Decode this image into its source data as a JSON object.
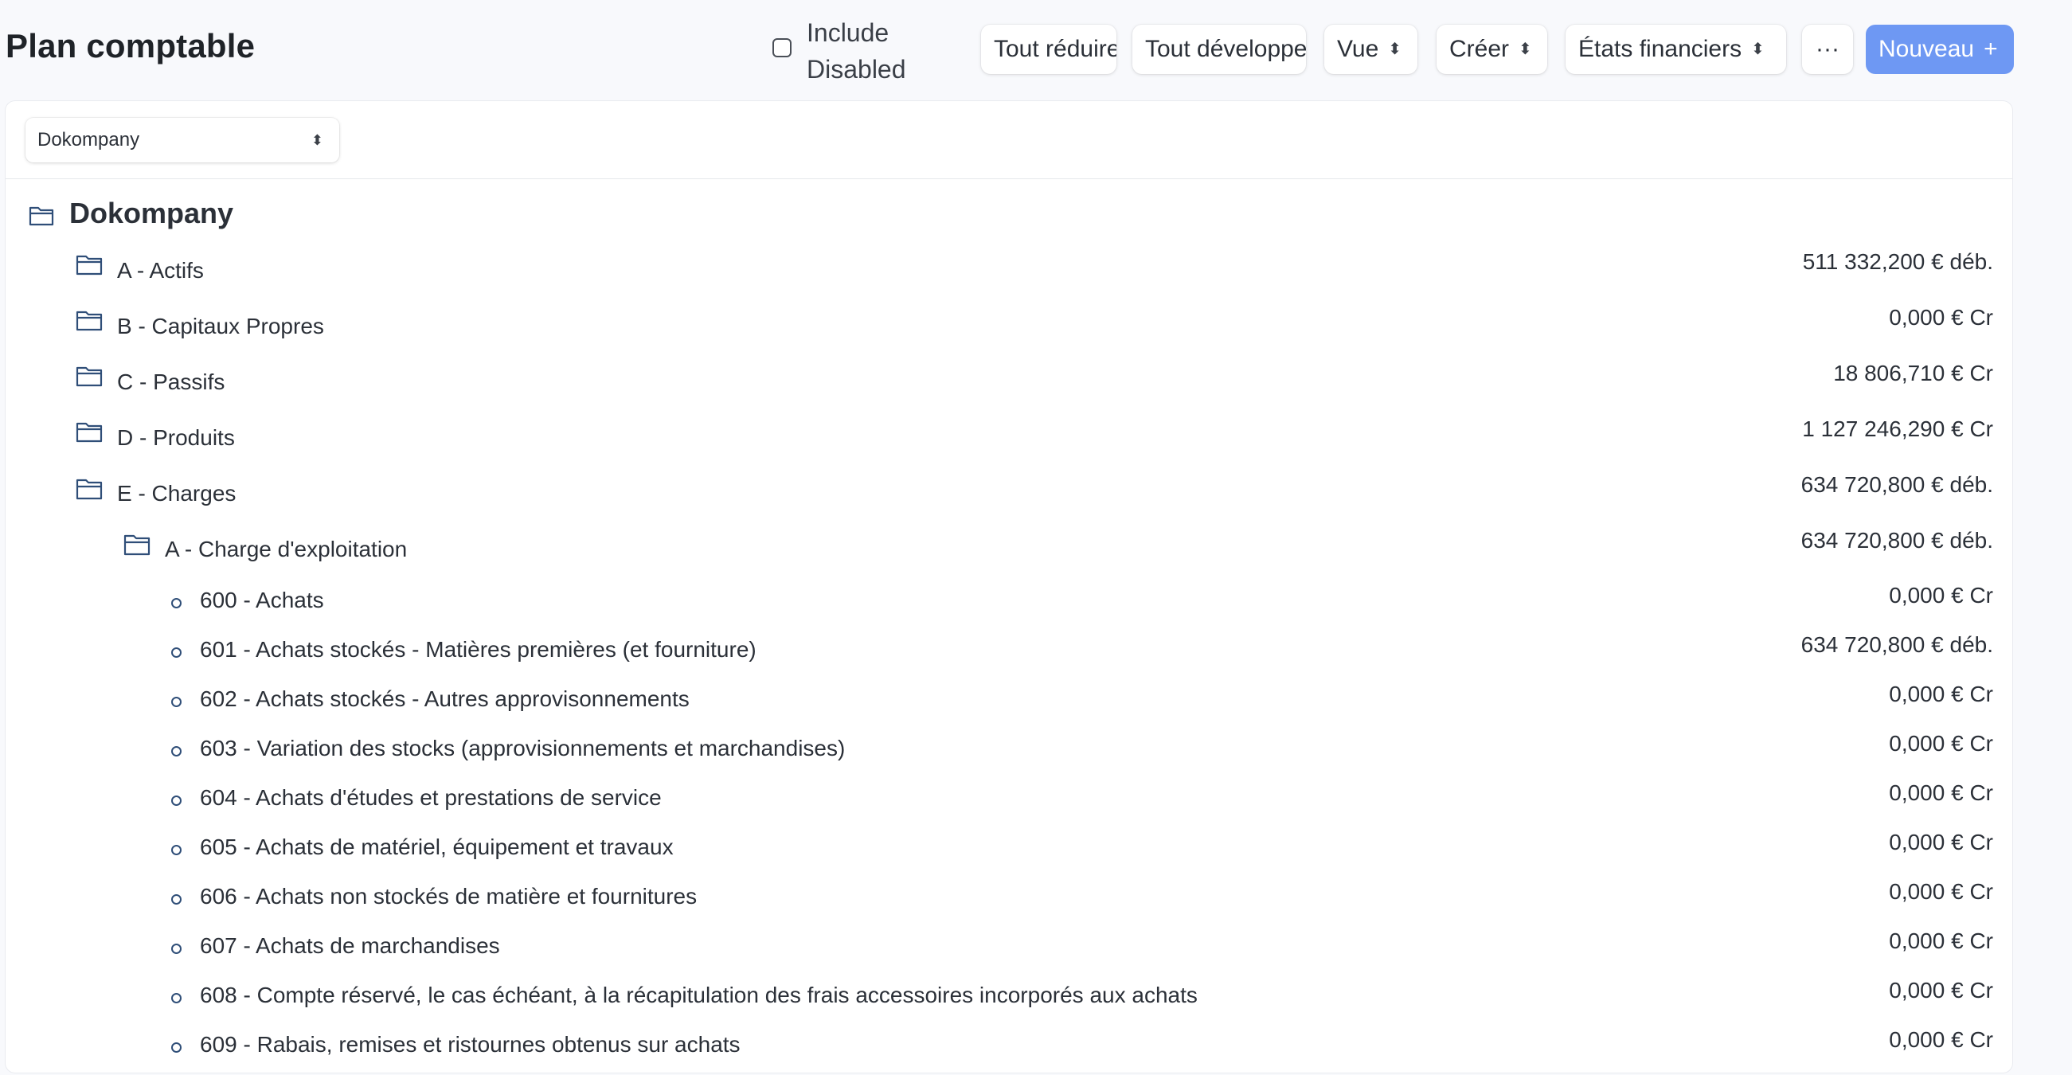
{
  "header": {
    "title": "Plan comptable",
    "include_disabled_label": "Include Disabled",
    "buttons": {
      "collapse_all": "Tout réduire",
      "expand_all": "Tout développer",
      "view": "Vue",
      "create": "Créer",
      "financial_statements": "États financiers",
      "more": "···",
      "new": "Nouveau"
    }
  },
  "company_select": {
    "value": "Dokompany"
  },
  "tree": {
    "root": {
      "label": "Dokompany",
      "icon": "folder-open-icon"
    },
    "groups": [
      {
        "label": "A - Actifs",
        "amount": "511 332,200 € déb.",
        "icon": "folder-icon"
      },
      {
        "label": "B - Capitaux Propres",
        "amount": "0,000 € Cr",
        "icon": "folder-icon"
      },
      {
        "label": "C - Passifs",
        "amount": "18 806,710 € Cr",
        "icon": "folder-icon"
      },
      {
        "label": "D - Produits",
        "amount": "1 127 246,290 € Cr",
        "icon": "folder-icon"
      },
      {
        "label": "E - Charges",
        "amount": "634 720,800 € déb.",
        "icon": "folder-open-icon"
      }
    ],
    "subgroup": {
      "label": "A - Charge d'exploitation",
      "amount": "634 720,800 € déb.",
      "icon": "folder-open-icon"
    },
    "accounts": [
      {
        "label": "600 - Achats",
        "amount": "0,000 € Cr"
      },
      {
        "label": "601 - Achats stockés - Matières premières (et fourniture)",
        "amount": "634 720,800 € déb."
      },
      {
        "label": "602 - Achats stockés - Autres approvisonnements",
        "amount": "0,000 € Cr"
      },
      {
        "label": "603 - Variation des stocks (approvisionnements et marchandises)",
        "amount": "0,000 € Cr"
      },
      {
        "label": "604 - Achats d'études et prestations de service",
        "amount": "0,000 € Cr"
      },
      {
        "label": "605 - Achats de matériel, équipement et travaux",
        "amount": "0,000 € Cr"
      },
      {
        "label": "606 - Achats non stockés de matière et fournitures",
        "amount": "0,000 € Cr"
      },
      {
        "label": "607 - Achats de marchandises",
        "amount": "0,000 € Cr"
      },
      {
        "label": "608 - Compte réservé, le cas échéant, à la récapitulation des frais accessoires incorporés aux achats",
        "amount": "0,000 € Cr"
      },
      {
        "label": "609 - Rabais, remises et ristournes obtenus sur achats",
        "amount": "0,000 € Cr"
      }
    ]
  },
  "colors": {
    "accent": "#6e98f3",
    "icon": "#2f4e78"
  }
}
